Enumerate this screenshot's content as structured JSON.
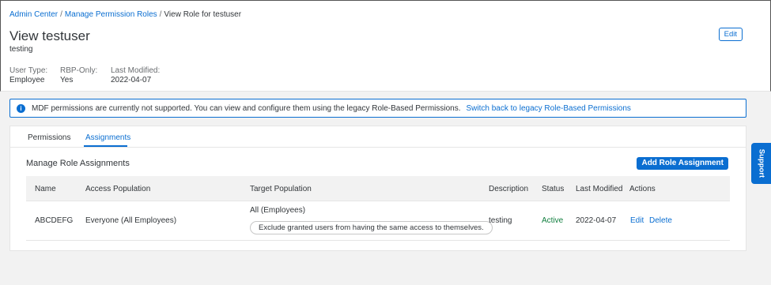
{
  "breadcrumb": {
    "items": [
      "Admin Center",
      "Manage Permission Roles"
    ],
    "current": "View Role for testuser",
    "separator": "/"
  },
  "header": {
    "title": "View testuser",
    "subtitle": "testing",
    "edit_label": "Edit",
    "attributes": [
      {
        "label": "User Type:",
        "value": "Employee"
      },
      {
        "label": "RBP-Only:",
        "value": "Yes"
      },
      {
        "label": "Last Modified:",
        "value": "2022-04-07"
      }
    ]
  },
  "info": {
    "icon": "info-icon",
    "glyph": "i",
    "message": "MDF permissions are currently not supported. You can view and configure them using the legacy Role-Based Permissions.",
    "link": "Switch back to legacy Role-Based Permissions"
  },
  "tabs": [
    {
      "label": "Permissions",
      "active": false
    },
    {
      "label": "Assignments",
      "active": true
    }
  ],
  "section": {
    "title": "Manage Role Assignments",
    "add_label": "Add Role Assignment"
  },
  "table": {
    "columns": [
      "Name",
      "Access Population",
      "Target Population",
      "Description",
      "Status",
      "Last Modified",
      "Actions"
    ],
    "rows": [
      {
        "name": "ABCDEFG",
        "access_population": "Everyone (All Employees)",
        "target_population": "All (Employees)",
        "target_note": "Exclude granted users from having the same access to themselves.",
        "description": "testing",
        "status": "Active",
        "last_modified": "2022-04-07",
        "actions": [
          "Edit",
          "Delete"
        ]
      }
    ]
  },
  "support": {
    "label": "Support"
  },
  "colors": {
    "accent": "#0a6ed1",
    "status_active": "#107e3e",
    "background": "#f2f2f2"
  }
}
